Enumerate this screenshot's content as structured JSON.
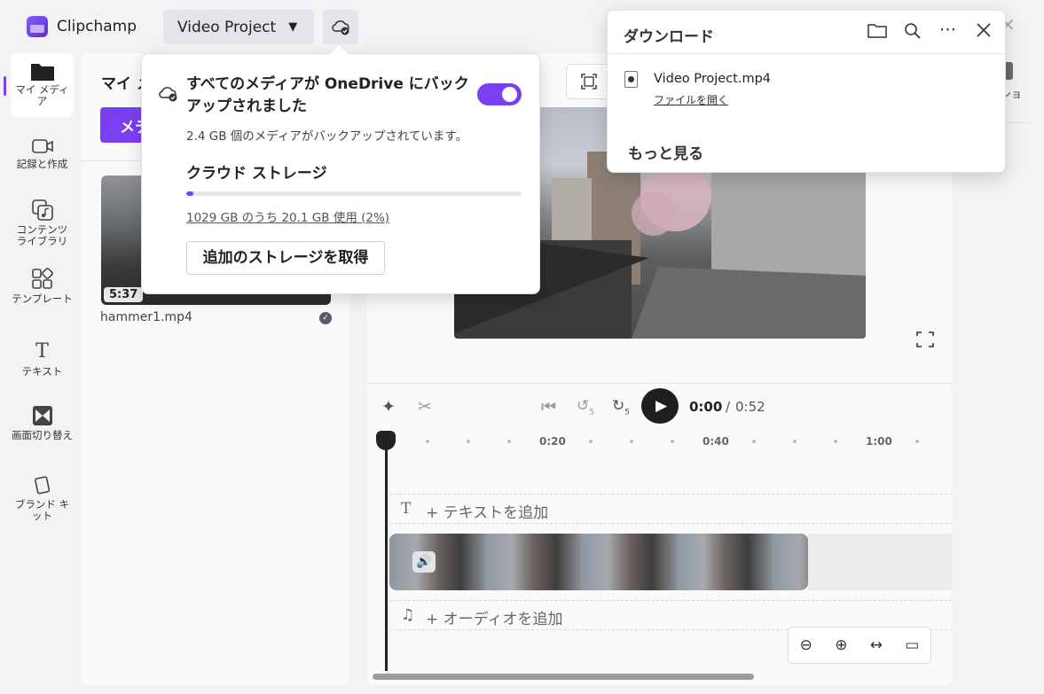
{
  "app": {
    "name": "Clipchamp",
    "project_name": "Video Project"
  },
  "rail": [
    {
      "label": "マイ メディア",
      "icon": "folder-icon",
      "glyph": "📁"
    },
    {
      "label": "記録と作成",
      "icon": "camera-icon",
      "glyph": "□"
    },
    {
      "label": "コンテンツ ライブラリ",
      "icon": "library-icon",
      "glyph": "♫"
    },
    {
      "label": "テンプレート",
      "icon": "template-icon",
      "glyph": "▦"
    },
    {
      "label": "テキスト",
      "icon": "text-icon",
      "glyph": "T"
    },
    {
      "label": "画面切り替え",
      "icon": "transition-icon",
      "glyph": "⧓"
    },
    {
      "label": "ブランド キット",
      "icon": "brand-kit-icon",
      "glyph": "◇"
    }
  ],
  "media": {
    "title": "マイ メ",
    "import_label": "メデ",
    "items": [
      {
        "name": "hammer1.mp4",
        "duration": "5:37"
      }
    ]
  },
  "playback": {
    "current": "0:00",
    "separator": "/",
    "total": "0:52",
    "skip_back": "5",
    "skip_forward": "5"
  },
  "ruler": {
    "labels": [
      "0:20",
      "0:40",
      "1:00"
    ]
  },
  "timeline": {
    "add_text": "+ テキストを追加",
    "add_audio": "+ オーディオを追加"
  },
  "right_panel": {
    "partial_label": "ショ"
  },
  "cloud_popup": {
    "title": "すべてのメディアが OneDrive にバックアップされました",
    "toggle_on": true,
    "backup_status": "2.4 GB 個のメディアがバックアップされています。",
    "storage_title": "クラウド ストレージ",
    "usage_text": "1029 GB のうち 20.1 GB 使用 (2%)",
    "usage_percent": 2,
    "get_storage_label": "追加のストレージを取得"
  },
  "downloads": {
    "title": "ダウンロード",
    "file_name": "Video Project.mp4",
    "open_file_label": "ファイルを開く",
    "more_label": "もっと見る"
  },
  "colors": {
    "accent": "#7b3ff2",
    "dark": "#1f1f1f"
  }
}
